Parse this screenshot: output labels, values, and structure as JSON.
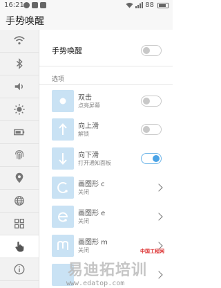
{
  "status_bar": {
    "time": "16:21",
    "battery": "88"
  },
  "header": {
    "title": "手势唤醒"
  },
  "sidebar": {
    "items": [
      {
        "icon": "wifi-icon"
      },
      {
        "icon": "bluetooth-icon"
      },
      {
        "icon": "volume-icon"
      },
      {
        "icon": "brightness-icon"
      },
      {
        "icon": "battery-icon"
      },
      {
        "icon": "fingerprint-icon"
      },
      {
        "icon": "location-icon"
      },
      {
        "icon": "globe-icon"
      },
      {
        "icon": "apps-grid-icon"
      },
      {
        "icon": "gesture-hand-icon",
        "active": true
      },
      {
        "icon": "info-icon"
      }
    ]
  },
  "main": {
    "master": {
      "label": "手势唤醒",
      "enabled": false
    },
    "section_label": "选项",
    "gestures": [
      {
        "title": "双击",
        "subtitle": "点亮屏幕",
        "control": "toggle",
        "enabled": false,
        "icon": "double-tap-icon"
      },
      {
        "title": "向上滑",
        "subtitle": "解锁",
        "control": "toggle",
        "enabled": false,
        "icon": "swipe-up-icon"
      },
      {
        "title": "向下滑",
        "subtitle": "打开通知面板",
        "control": "toggle",
        "enabled": true,
        "icon": "swipe-down-icon"
      },
      {
        "title": "画图形 c",
        "subtitle": "关闭",
        "control": "chevron",
        "icon": "draw-c-icon"
      },
      {
        "title": "画图形 e",
        "subtitle": "关闭",
        "control": "chevron",
        "icon": "draw-e-icon"
      },
      {
        "title": "画图形 m",
        "subtitle": "关闭",
        "control": "chevron",
        "icon": "draw-m-icon"
      }
    ]
  },
  "watermark": {
    "main": "易迪拓培训",
    "sub": "中国工程网",
    "url": "www.edatop.com"
  },
  "colors": {
    "accent": "#4aa3e6",
    "icon_bg": "#c9e2f4"
  }
}
